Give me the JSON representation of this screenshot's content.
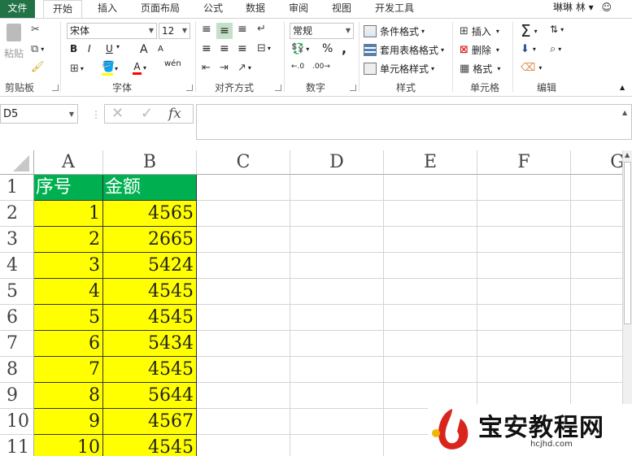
{
  "tabs": {
    "file": "文件",
    "items": [
      "开始",
      "插入",
      "页面布局",
      "公式",
      "数据",
      "审阅",
      "视图",
      "开发工具"
    ],
    "user": "琳琳 林"
  },
  "ribbon": {
    "clipboard": {
      "paste": "粘贴",
      "label": "剪贴板"
    },
    "font": {
      "name": "宋体",
      "size": "12",
      "bold": "B",
      "italic": "I",
      "underline": "U",
      "grow": "A",
      "shrink": "A",
      "wen": "wén",
      "label": "字体"
    },
    "alignment": {
      "label": "对齐方式"
    },
    "number": {
      "format": "常规",
      "percent": "%",
      "comma": ",",
      "label": "数字"
    },
    "styles": {
      "conditional": "条件格式",
      "table": "套用表格格式",
      "cell": "单元格样式",
      "label": "样式"
    },
    "cells": {
      "insert": "插入",
      "delete": "删除",
      "format": "格式",
      "label": "单元格"
    },
    "editing": {
      "label": "编辑"
    }
  },
  "formula_bar": {
    "name_box": "D5",
    "fx": "fx"
  },
  "sheet": {
    "columns": [
      "A",
      "B",
      "C",
      "D",
      "E",
      "F",
      "G"
    ],
    "rows": [
      "1",
      "2",
      "3",
      "4",
      "5",
      "6",
      "7",
      "8",
      "9",
      "10",
      "11"
    ],
    "header": [
      "序号",
      "金额"
    ],
    "data": [
      [
        "1",
        "4565"
      ],
      [
        "2",
        "2665"
      ],
      [
        "3",
        "5424"
      ],
      [
        "4",
        "4545"
      ],
      [
        "5",
        "4545"
      ],
      [
        "6",
        "5434"
      ],
      [
        "7",
        "4545"
      ],
      [
        "8",
        "5644"
      ],
      [
        "9",
        "4567"
      ],
      [
        "10",
        "4545"
      ]
    ]
  },
  "watermark": {
    "title": "宝安教程网",
    "url": "hcjhd.com"
  },
  "colors": {
    "header_fill": "#00b050",
    "data_fill": "#ffff00",
    "excel_green": "#217346"
  }
}
